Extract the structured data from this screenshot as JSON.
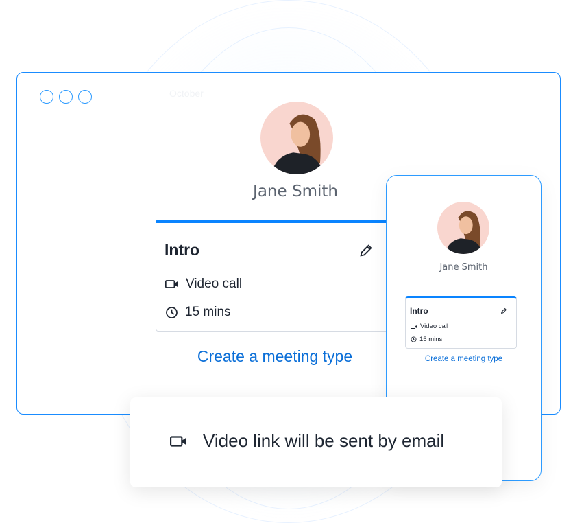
{
  "colors": {
    "accent": "#0a84ff",
    "link": "#0b6fd8",
    "avatar_bg": "#f9d6cf"
  },
  "desktop": {
    "calendar_month": "October",
    "profile": {
      "name": "Jane Smith"
    },
    "meeting_card": {
      "title": "Intro",
      "edit_icon": "pencil-icon",
      "type": "Video call",
      "type_icon": "video-camera-icon",
      "duration": "15 mins",
      "duration_icon": "clock-icon"
    },
    "create_link": "Create a meeting type"
  },
  "mobile": {
    "profile": {
      "name": "Jane Smith"
    },
    "meeting_card": {
      "title": "Intro",
      "type": "Video call",
      "duration": "15 mins"
    },
    "create_link": "Create a meeting type"
  },
  "toast": {
    "icon": "video-camera-icon",
    "text": "Video link will be sent by email"
  }
}
